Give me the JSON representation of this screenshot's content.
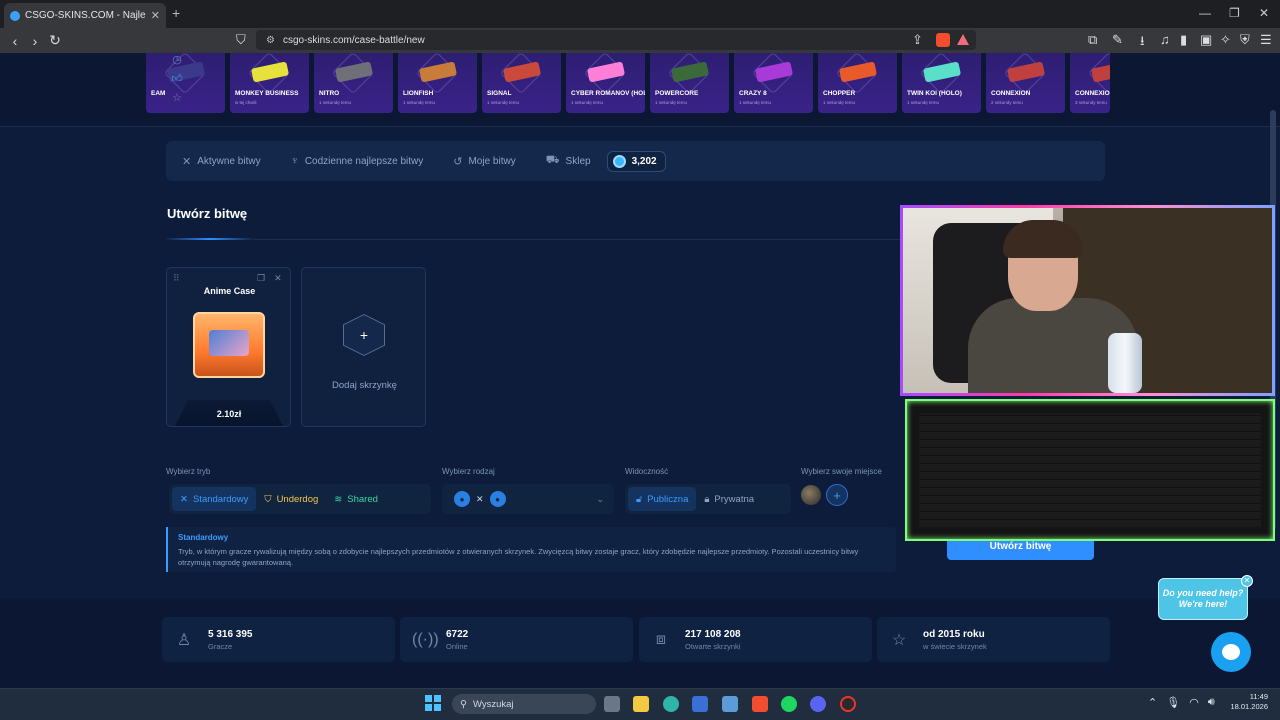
{
  "browser": {
    "tab_title": "CSGO-SKINS.COM - Najlepsze S",
    "url": "csgo-skins.com/case-battle/new"
  },
  "recent_drops": [
    {
      "name": "EAM",
      "time": "",
      "color": "#3b3a8a"
    },
    {
      "name": "MONKEY BUSINESS",
      "time": "w tej chwili",
      "color": "#e7e23b"
    },
    {
      "name": "NITRO",
      "time": "1 sekundę temu",
      "color": "#6f6f78"
    },
    {
      "name": "LIONFISH",
      "time": "1 sekundę temu",
      "color": "#c97b3a"
    },
    {
      "name": "SIGNAL",
      "time": "1 sekundę temu",
      "color": "#c94a3a"
    },
    {
      "name": "CYBER ROMANOV (HOLO)",
      "time": "1 sekundę temu",
      "color": "#ff7fd8"
    },
    {
      "name": "POWERCORE",
      "time": "1 sekundę temu",
      "color": "#3a6a3a"
    },
    {
      "name": "CRAZY 8",
      "time": "1 sekundę temu",
      "color": "#a83ad8"
    },
    {
      "name": "CHOPPER",
      "time": "1 sekundę temu",
      "color": "#e85a2a"
    },
    {
      "name": "TWIN KOI (HOLO)",
      "time": "1 sekundę temu",
      "color": "#5ae0c8"
    },
    {
      "name": "CONNEXION",
      "time": "2 sekundy temu",
      "color": "#c04040"
    },
    {
      "name": "CONNEXIO",
      "time": "3 sekundy temu",
      "color": "#c04040"
    }
  ],
  "menu": {
    "active": "Aktywne bitwy",
    "daily": "Codzienne najlepsze bitwy",
    "mine": "Moje bitwy",
    "shop": "Sklep",
    "balance": "3,202"
  },
  "create": {
    "title": "Utwórz bitwę",
    "case_name": "Anime Case",
    "case_price": "2.10zł",
    "add_case": "Dodaj skrzynkę"
  },
  "options": {
    "mode_label": "Wybierz tryb",
    "modes": [
      "Standardowy",
      "Underdog",
      "Shared"
    ],
    "type_label": "Wybierz rodzaj",
    "visibility_label": "Widoczność",
    "public": "Publiczna",
    "private": "Prywatna",
    "seat_label": "Wybierz swoje miejsce"
  },
  "description": {
    "title": "Standardowy",
    "body": "Tryb, w którym gracze rywalizują między sobą o zdobycie najlepszych przedmiotów z otwieranych skrzynek. Zwycięzcą bitwy zostaje gracz, który zdobędzie najlepsze przedmioty. Pozostali uczestnicy bitwy otrzymują nagrodę gwarantowaną."
  },
  "create_button": "Utwórz bitwę",
  "stats": [
    {
      "value": "5 316 395",
      "label": "Gracze"
    },
    {
      "value": "6722",
      "label": "Online"
    },
    {
      "value": "217 108 208",
      "label": "Otwarte skrzynki"
    },
    {
      "value": "od 2015 roku",
      "label": "w świecie skrzynek"
    }
  ],
  "chat": {
    "help": "Do you need help? We're here!"
  },
  "taskbar": {
    "search": "Wyszukaj",
    "time": "11:49",
    "date": "18.01.2026"
  }
}
